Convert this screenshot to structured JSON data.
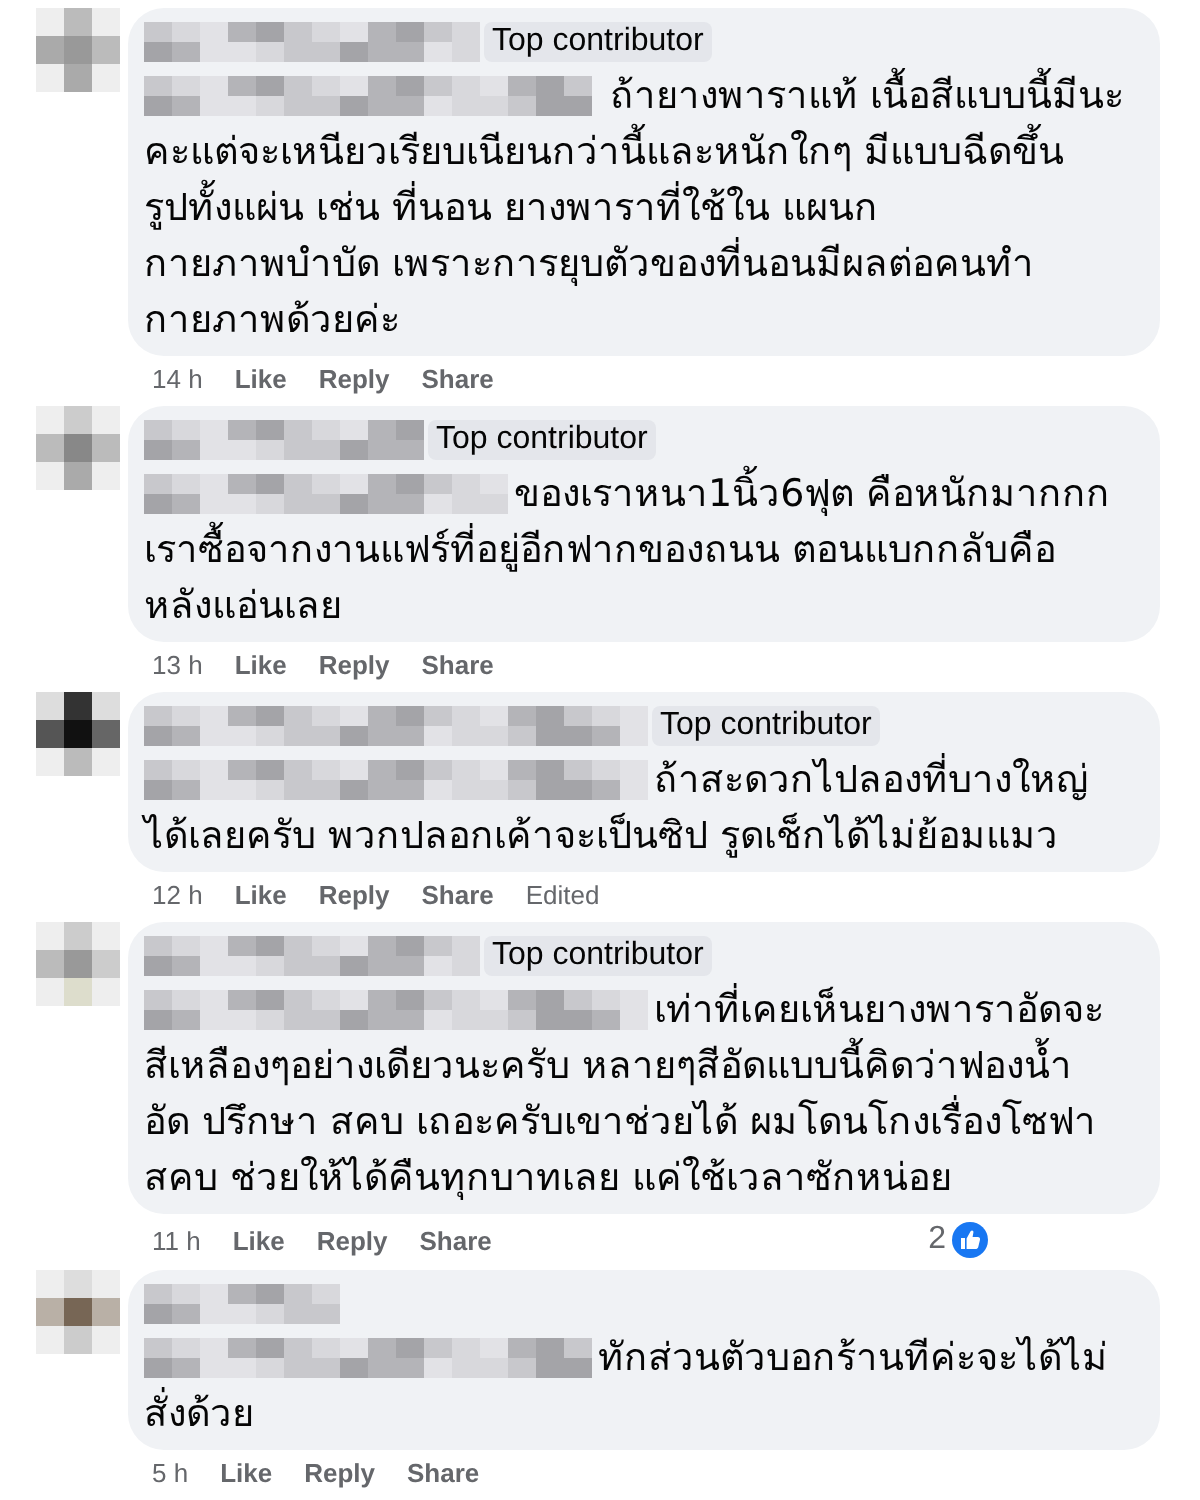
{
  "comments": [
    {
      "badge": "Top contributor",
      "lines": [
        "ถ้ายางพาราแท้ เนื้อสีแบบนี้มีนะ",
        "คะแต่จะเหนียวเรียบเนียนกว่านี้และหนักใกๆ มีแบบฉีดขึ้น",
        "รูปทั้งแผ่น เช่น ที่นอน ยางพาราที่ใช้ใน แผนก",
        "กายภาพบำบัด เพราะการยุบตัวของที่นอนมีผลต่อคนทำ",
        "กายภาพด้วยค่ะ"
      ],
      "time": "14 h",
      "actions": [
        "Like",
        "Reply",
        "Share"
      ]
    },
    {
      "badge": "Top contributor",
      "lines": [
        "ของเราหนา1นิ้ว6ฟุต คือหนักมากกก",
        "เราซื้อจากงานแฟร์ที่อยู่อีกฟากของถนน ตอนแบกกลับคือ",
        "หลังแอ่นเลย"
      ],
      "time": "13 h",
      "actions": [
        "Like",
        "Reply",
        "Share"
      ]
    },
    {
      "badge": "Top contributor",
      "lines": [
        "ถ้าสะดวกไปลองที่บางใหญ่",
        "ได้เลยครับ พวกปลอกเค้าจะเป็นซิป รูดเช็กได้ไม่ย้อมแมว"
      ],
      "time": "12 h",
      "actions": [
        "Like",
        "Reply",
        "Share"
      ],
      "note": "Edited"
    },
    {
      "badge": "Top contributor",
      "lines": [
        "เท่าที่เคยเห็นยางพาราอัดจะ",
        "สีเหลืองๆอย่างเดียวนะครับ หลายๆสีอัดแบบนี้คิดว่าฟองน้ำ",
        "อัด ปรึกษา สคบ เถอะครับเขาช่วยได้ ผมโดนโกงเรื่องโซฟา",
        "สคบ ช่วยให้ได้คืนทุกบาทเลย แค่ใช้เวลาซักหน่อย"
      ],
      "time": "11 h",
      "actions": [
        "Like",
        "Reply",
        "Share"
      ],
      "reactions": "2"
    },
    {
      "lines": [
        "ทักส่วนตัวบอกร้านทีค่ะจะได้ไม่",
        "สั่งด้วย"
      ],
      "time": "5 h",
      "actions": [
        "Like",
        "Reply",
        "Share"
      ]
    }
  ]
}
